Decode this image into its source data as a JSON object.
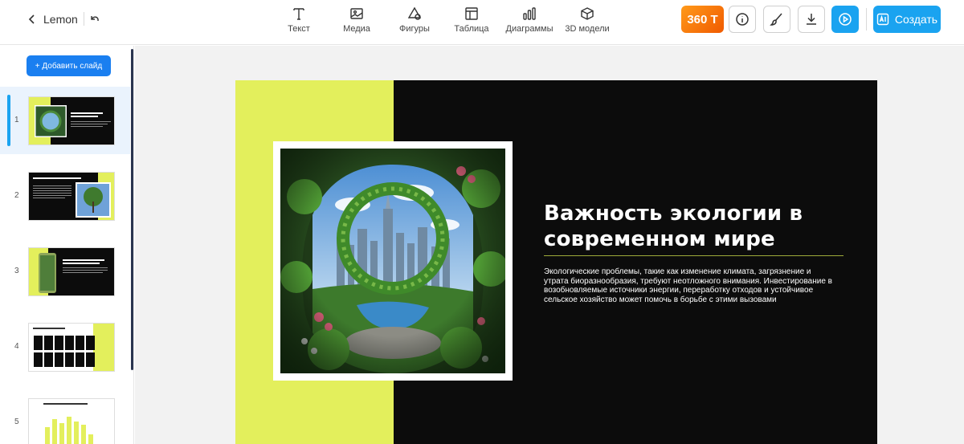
{
  "header": {
    "back_title": "Lemon",
    "tools": [
      {
        "label": "Текст",
        "icon": "text-icon"
      },
      {
        "label": "Медиа",
        "icon": "image-icon"
      },
      {
        "label": "Фигуры",
        "icon": "shapes-icon"
      },
      {
        "label": "Таблица",
        "icon": "table-icon"
      },
      {
        "label": "Диаграммы",
        "icon": "chart-icon"
      },
      {
        "label": "3D модели",
        "icon": "cube-icon"
      }
    ],
    "tokens_label": "360 T",
    "create_label": "Создать",
    "accent_color": "#1aa3f0",
    "tokens_color": "#f57a0a"
  },
  "sidebar": {
    "add_slide_label": "+ Добавить слайд",
    "slides": [
      {
        "number": "1",
        "title": "Важность экологии в современном мире"
      },
      {
        "number": "2",
        "title": "Экологические проблемы современности"
      },
      {
        "number": "3",
        "title": "Влияние человеческой деятельности на окружающую среду"
      },
      {
        "number": "4",
        "title": "Загрязнение воздуха"
      },
      {
        "number": "5",
        "title": "Вопросы экологии – что нас ждет?"
      }
    ]
  },
  "slide": {
    "title": "Важность экологии в современном мире",
    "body": "Экологические проблемы, такие как изменение климата, загрязнение и утрата биоразнообразия, требуют неотложного внимания. Инвестирование в возобновляемые источники энергии, переработку отходов и устойчивое сельское хозяйство может помочь в борьбе с этими вызовами",
    "lime_color": "#e3ef5c",
    "background_color": "#0c0c0c"
  }
}
